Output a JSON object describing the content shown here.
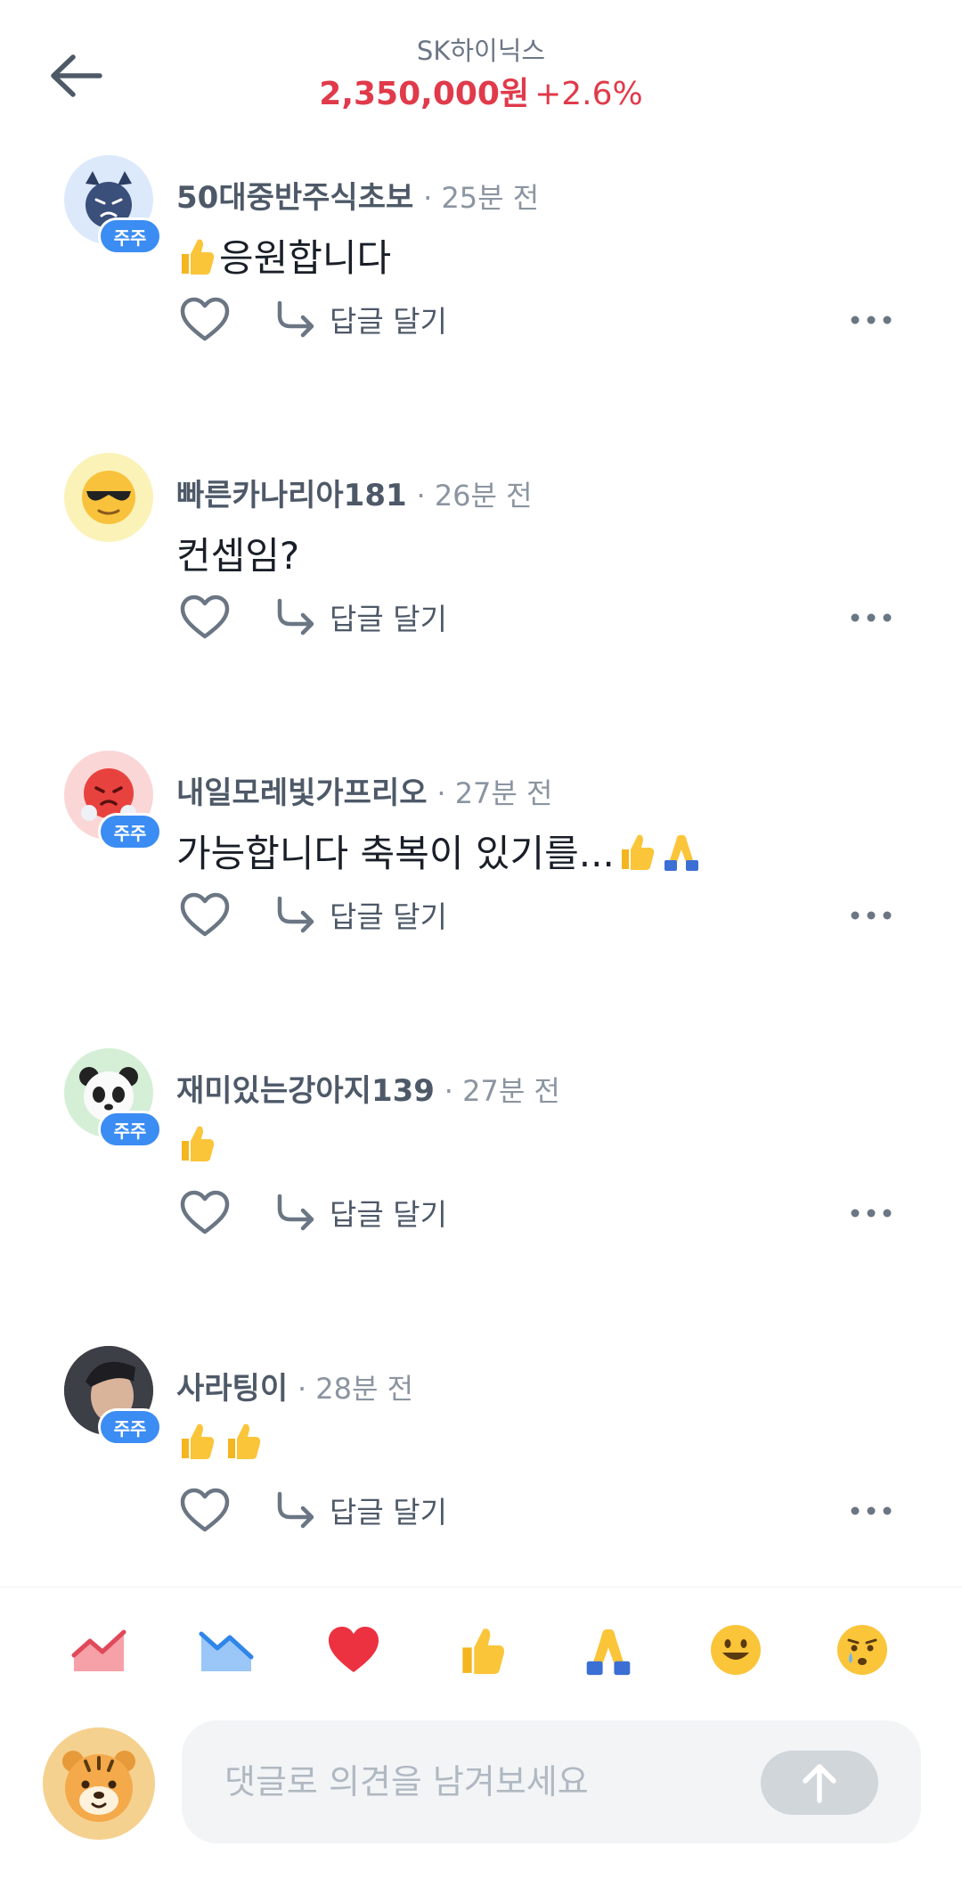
{
  "header": {
    "stock_name": "SK하이닉스",
    "price": "2,350,000원",
    "change": "+2.6%"
  },
  "comments": [
    {
      "nickname": "50대중반주식초보",
      "time": "· 25분 전",
      "text": "응원합니다",
      "badge": "주주",
      "reply_label": "답글 달기",
      "prefix_emoji": "thumbs-up"
    },
    {
      "nickname": "빠른카나리아181",
      "time": "· 26분 전",
      "text": "컨셉임?",
      "badge": "",
      "reply_label": "답글 달기"
    },
    {
      "nickname": "내일모레빛가프리오",
      "time": "· 27분 전",
      "text": "가능합니다 축복이 있기를...",
      "badge": "주주",
      "reply_label": "답글 달기",
      "suffix_emoji": [
        "thumbs-up",
        "folded-hands"
      ]
    },
    {
      "nickname": "재미있는강아지139",
      "time": "· 27분 전",
      "text": "",
      "badge": "주주",
      "reply_label": "답글 달기",
      "emoji_only": [
        "thumbs-up"
      ]
    },
    {
      "nickname": "사라팅이",
      "time": "· 28분 전",
      "text": "",
      "badge": "주주",
      "reply_label": "답글 달기",
      "emoji_only": [
        "thumbs-up",
        "thumbs-up"
      ]
    }
  ],
  "reactions": [
    "chart-up-icon",
    "chart-down-icon",
    "heart-icon",
    "thumbs-up-icon",
    "folded-hands-icon",
    "smile-icon",
    "crying-icon"
  ],
  "input": {
    "placeholder": "댓글로 의견을 남겨보세요"
  },
  "colors": {
    "price_red": "#e03a4b",
    "badge_blue": "#3b8cf3",
    "muted_gray": "#8b95a1"
  }
}
